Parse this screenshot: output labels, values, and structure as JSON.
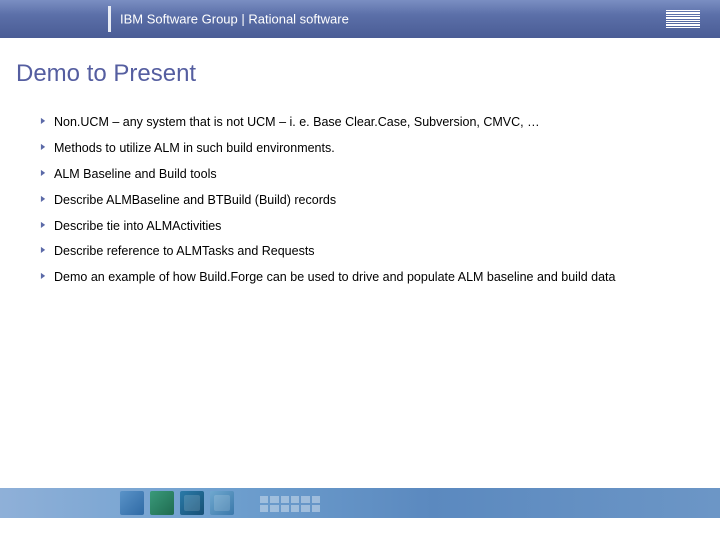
{
  "header": {
    "title": "IBM Software Group | Rational software",
    "logo": "IBM"
  },
  "slide": {
    "title": "Demo to Present"
  },
  "bullets": [
    "Non.UCM – any system that is not UCM – i. e. Base Clear.Case,  Subversion, CMVC, …",
    "Methods to utilize ALM in such build environments.",
    "ALM Baseline and Build tools",
    "Describe ALMBaseline and BTBuild (Build) records",
    "Describe tie into ALMActivities",
    "Describe reference to ALMTasks and Requests",
    "Demo an example of how Build.Forge can be used to drive and populate ALM baseline and build data"
  ],
  "colors": {
    "accent": "#5c6aa8",
    "title": "#555ea0"
  }
}
